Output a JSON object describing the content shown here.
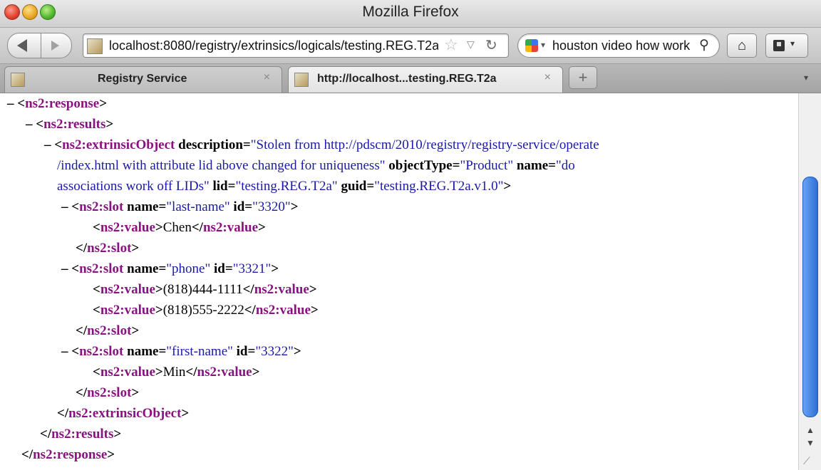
{
  "window": {
    "title": "Mozilla Firefox"
  },
  "nav": {
    "url": "localhost:8080/registry/extrinsics/logicals/testing.REG.T2a",
    "search_text": "houston video how work",
    "star_icon": "star-icon",
    "reload_icon": "reload-icon",
    "home_icon": "home-icon",
    "bookmarks_icon": "bookmarks-icon"
  },
  "tabs": [
    {
      "label": "Registry Service",
      "active": false,
      "close": "×"
    },
    {
      "label": "http://localhost...testing.REG.T2a",
      "active": true,
      "close": "×"
    }
  ],
  "new_tab": "+",
  "xml": {
    "toggle": "–",
    "response_tag": "ns2:response",
    "results_tag": "ns2:results",
    "extrinsic_tag": "ns2:extrinsicObject",
    "slot_tag": "ns2:slot",
    "value_tag": "ns2:value",
    "extrinsic_attrs": {
      "description_name": "description",
      "description_value_1": "Stolen from http://pdscm/2010/registry/registry-service/operate",
      "description_value_2": "/index.html with attribute lid above changed for uniqueness",
      "objectType_name": "objectType",
      "objectType_value": "Product",
      "name_name": "name",
      "name_value_1": "do",
      "name_value_2": "associations work off LIDs",
      "lid_name": "lid",
      "lid_value": "testing.REG.T2a",
      "guid_name": "guid",
      "guid_value": "testing.REG.T2a.v1.0"
    },
    "slots": [
      {
        "name_attr": "name",
        "name": "last-name",
        "id_attr": "id",
        "id": "3320",
        "values": [
          "Chen"
        ]
      },
      {
        "name_attr": "name",
        "name": "phone",
        "id_attr": "id",
        "id": "3321",
        "values": [
          "(818)444-1111",
          "(818)555-2222"
        ]
      },
      {
        "name_attr": "name",
        "name": "first-name",
        "id_attr": "id",
        "id": "3322",
        "values": [
          "Min"
        ]
      }
    ]
  }
}
